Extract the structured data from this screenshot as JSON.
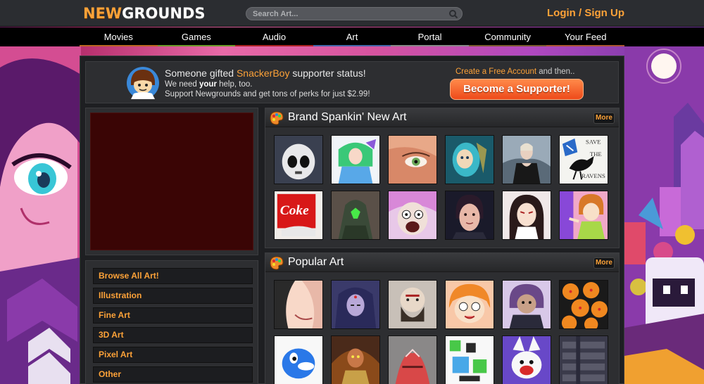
{
  "header": {
    "logo_new": "NEW",
    "logo_grounds": "GROUNDS",
    "search_placeholder": "Search Art...",
    "login_label": "Login / Sign Up"
  },
  "nav": {
    "items": [
      "Movies",
      "Games",
      "Audio",
      "Art",
      "Portal",
      "Community",
      "Your Feed"
    ]
  },
  "banner": {
    "line1_pre": "Someone gifted ",
    "line1_user": "SnackerBoy",
    "line1_post": " supporter status!",
    "line2_pre": "We need ",
    "line2_bold": "your",
    "line2_post": " help, too.",
    "line3": "Support Newgrounds and get tons of perks for just $2.99!",
    "create_account": "Create a Free Account",
    "and_then": " and then..",
    "supporter_button": "Become a Supporter!"
  },
  "categories": [
    "Browse All Art!",
    "Illustration",
    "Fine Art",
    "3D Art",
    "Pixel Art",
    "Other"
  ],
  "sections": {
    "new_art": {
      "title": "Brand Spankin' New Art",
      "more": "More"
    },
    "popular_art": {
      "title": "Popular Art",
      "more": "More"
    }
  },
  "tile_texts": {
    "coke": "Coke",
    "ravens": [
      "SAVE",
      "THE",
      "RAVENS"
    ]
  },
  "colors": {
    "accent": "#fda238",
    "topbar": "#2b2d31",
    "panel": "#2d2e31",
    "ad": "#3a0505",
    "supporter_btn": "#ee4a1a"
  }
}
